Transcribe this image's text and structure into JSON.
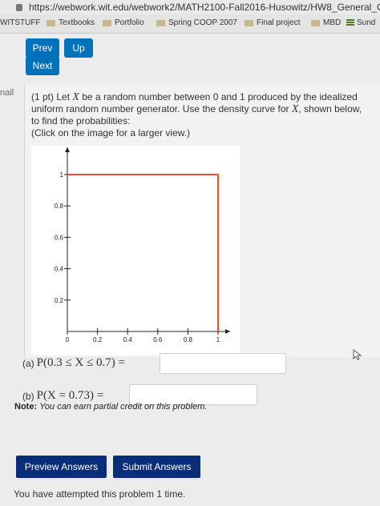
{
  "browser": {
    "url": "https://webwork.wit.edu/webwork2/MATH2100-Fall2016-Husowitz/HW8_General_C",
    "bookmarks": [
      {
        "label": "WITSTUFF",
        "icon": "none"
      },
      {
        "label": "Textbooks",
        "icon": "folder-icon"
      },
      {
        "label": "Portfolio",
        "icon": "folder-icon"
      },
      {
        "label": "Spring COOP 2007",
        "icon": "folder-icon"
      },
      {
        "label": "Final project",
        "icon": "folder-icon"
      },
      {
        "label": "MBD",
        "icon": "folder-icon"
      },
      {
        "label": "Sund",
        "icon": "stack-icon"
      }
    ]
  },
  "nav": {
    "prev": "Prev",
    "up": "Up",
    "next": "Next"
  },
  "sidebar": {
    "label": "nail"
  },
  "problem": {
    "text_parts": [
      "(1 pt) Let ",
      "X",
      " be a random number between 0 and 1 produced by the idealized uniform random number generator. Use the density curve for ",
      "X",
      ", shown below, to find the probabilities:"
    ],
    "hint": "(Click on the image for a larger view.)",
    "graph": {
      "x_ticks": [
        "0",
        "0.2",
        "0.4",
        "0.6",
        "0.8",
        "1"
      ],
      "y_ticks": [
        "0.2",
        "0.4",
        "0.6",
        "0.8",
        "1"
      ],
      "x_values": [
        0,
        0.2,
        0.4,
        0.6,
        0.8,
        1
      ],
      "y_values": [
        0.2,
        0.4,
        0.6,
        0.8,
        1
      ],
      "density_height": 1,
      "density_range": [
        0,
        1
      ],
      "curve_color": "#e8502e"
    }
  },
  "answers": {
    "a_label": "(a) ",
    "a_math": "P(0.3 ≤ X ≤ 0.7) =",
    "a_value": "",
    "b_label": "(b) ",
    "b_math": "P(X = 0.73) =",
    "b_value": ""
  },
  "note": {
    "bold": "Note:",
    "text": "You can earn partial credit on this problem."
  },
  "buttons": {
    "preview": "Preview Answers",
    "submit": "Submit Answers"
  },
  "attempts": "You have attempted this problem 1 time.",
  "colors": {
    "nav_button": "#0072bc",
    "action_button": "#0a2d79"
  }
}
